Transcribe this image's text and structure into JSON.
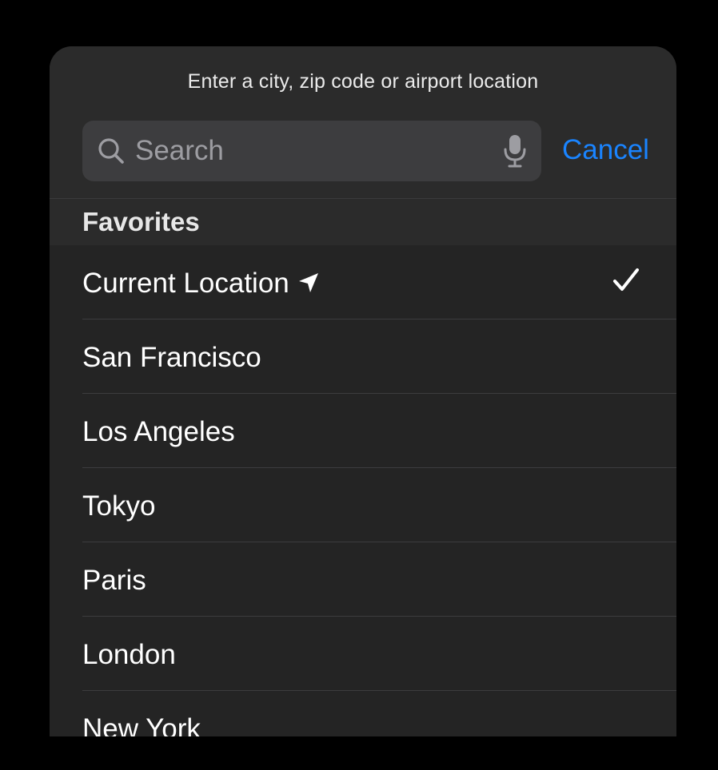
{
  "header": {
    "prompt": "Enter a city, zip code or airport location",
    "search": {
      "placeholder": "Search",
      "value": ""
    },
    "cancel_label": "Cancel"
  },
  "favorites": {
    "title": "Favorites",
    "items": [
      {
        "label": "Current Location",
        "icon": "location-arrow-icon",
        "selected": true
      },
      {
        "label": "San Francisco"
      },
      {
        "label": "Los Angeles"
      },
      {
        "label": "Tokyo"
      },
      {
        "label": "Paris"
      },
      {
        "label": "London"
      },
      {
        "label": "New York"
      }
    ]
  },
  "colors": {
    "accent": "#1a84ff",
    "sheet_background": "#242424",
    "header_background": "#2b2b2b",
    "search_field": "#3d3d3f",
    "placeholder": "#9d9da2",
    "text": "#ffffff"
  }
}
